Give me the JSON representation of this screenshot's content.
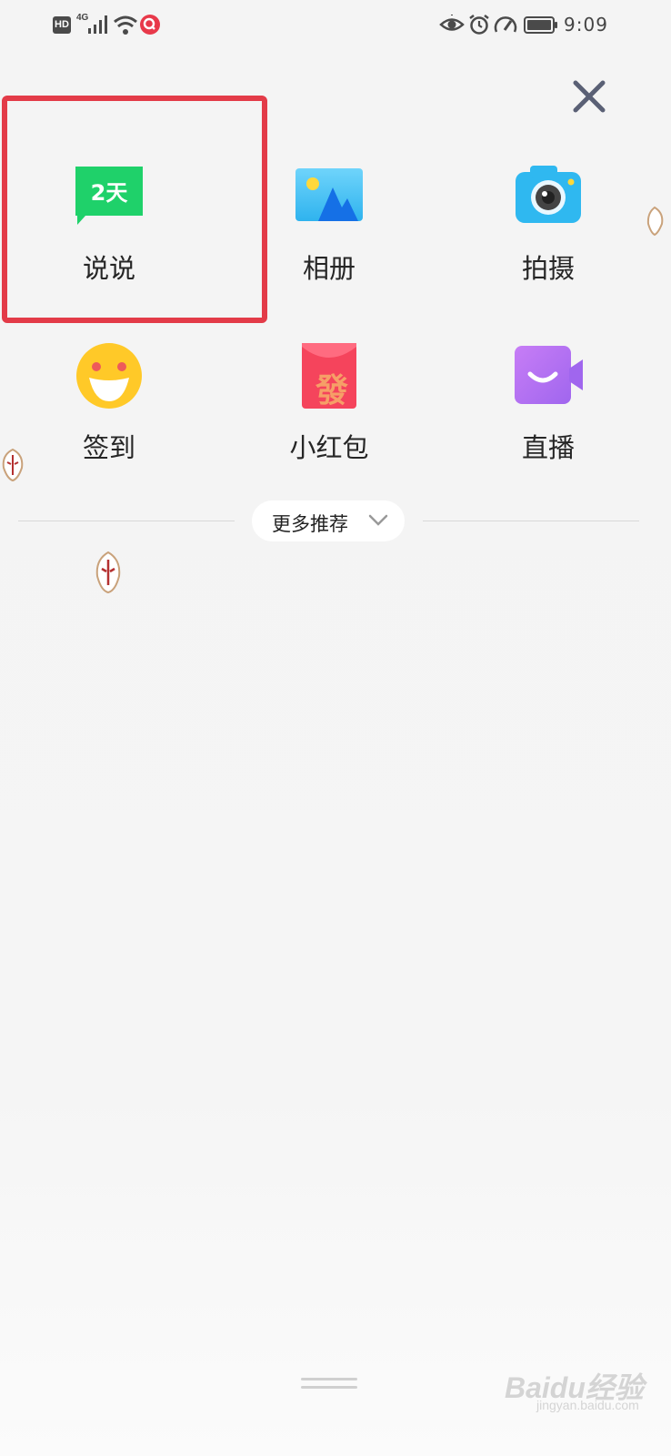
{
  "status_bar": {
    "hd_label": "HD",
    "network_label": "4G",
    "time": "9:09"
  },
  "menu": {
    "close_icon": "close-icon",
    "items": [
      {
        "label": "说说",
        "icon": "shuoshuo-icon",
        "badge_text": "2天",
        "color": "#1fd16a"
      },
      {
        "label": "相册",
        "icon": "album-icon",
        "color": "#3ac3f5"
      },
      {
        "label": "拍摄",
        "icon": "camera-icon",
        "color": "#2fb8f0"
      },
      {
        "label": "签到",
        "icon": "checkin-icon",
        "color": "#ffc928"
      },
      {
        "label": "小红包",
        "icon": "red-packet-icon",
        "color": "#f5445c"
      },
      {
        "label": "直播",
        "icon": "live-icon",
        "color": "#b374f0"
      }
    ],
    "highlight_color": "#e33b48"
  },
  "more": {
    "label": "更多推荐"
  },
  "watermark": {
    "text": "Baidu经验",
    "sub": "jingyan.baidu.com"
  }
}
